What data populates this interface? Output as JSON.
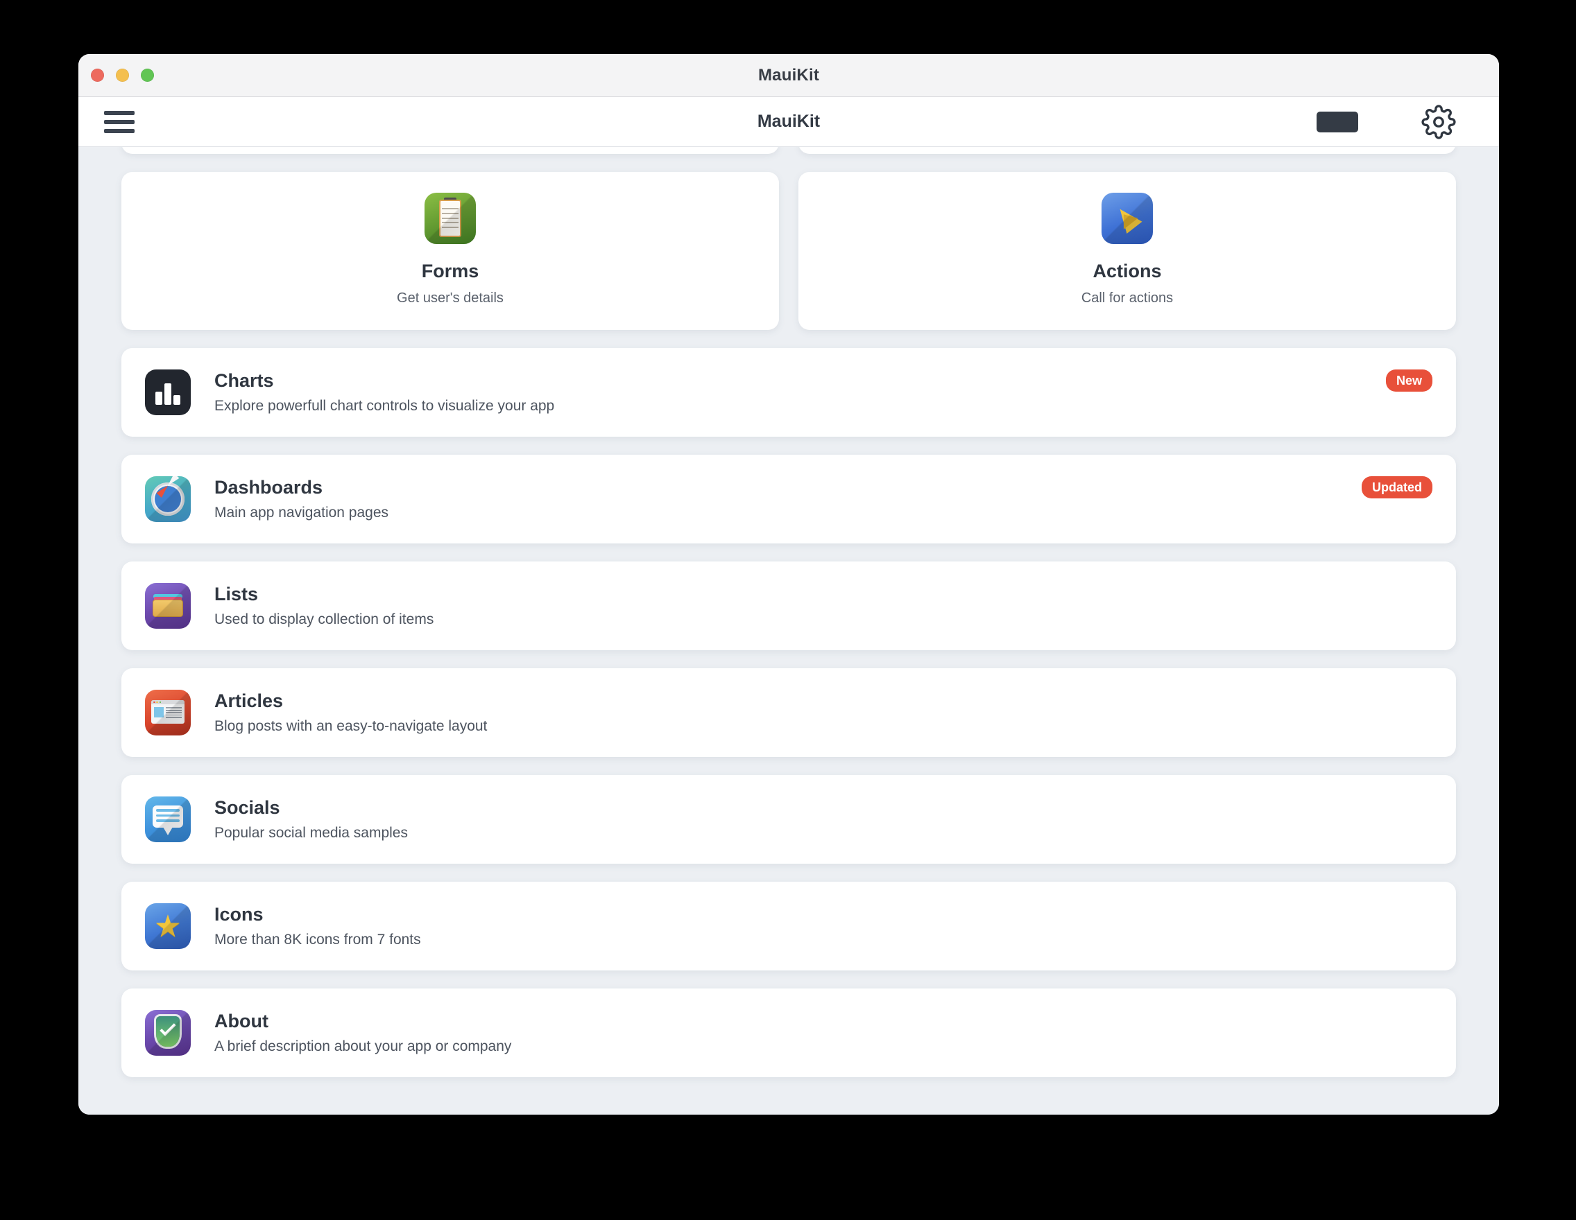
{
  "window": {
    "title": "MauiKit",
    "traffic_lights": {
      "close_color": "#ED6A5E",
      "minimize_color": "#F4BF4F",
      "maximize_color": "#61C554"
    }
  },
  "toolbar": {
    "menu_icon": "hamburger-menu-icon",
    "title": "MauiKit",
    "theme_toggle_icon": "dark-mode-toggle",
    "settings_icon": "gear-icon",
    "background": "#FFFFFF"
  },
  "theme": {
    "page_background": "#ECEFF3",
    "card_background": "#FFFFFF",
    "badge_color": "#E8503A",
    "title_color": "#2F3640",
    "subtitle_color": "#4D545F"
  },
  "feature_cards": [
    {
      "title": "Forms",
      "subtitle": "Get user's details",
      "icon": "clipboard-icon",
      "icon_class": "ico-forms"
    },
    {
      "title": "Actions",
      "subtitle": "Call for actions",
      "icon": "paper-plane-icon",
      "icon_class": "ico-actions"
    }
  ],
  "list_rows": [
    {
      "title": "Charts",
      "subtitle": "Explore powerfull chart controls to visualize your app",
      "icon": "bar-chart-icon",
      "icon_class": "ico-charts",
      "badge": "New"
    },
    {
      "title": "Dashboards",
      "subtitle": "Main app navigation pages",
      "icon": "compass-icon",
      "icon_class": "ico-dash",
      "badge": "Updated"
    },
    {
      "title": "Lists",
      "subtitle": "Used to display collection of items",
      "icon": "card-stack-icon",
      "icon_class": "ico-lists",
      "badge": ""
    },
    {
      "title": "Articles",
      "subtitle": "Blog posts with an easy-to-navigate layout",
      "icon": "browser-window-icon",
      "icon_class": "ico-articles",
      "badge": ""
    },
    {
      "title": "Socials",
      "subtitle": "Popular social media samples",
      "icon": "speech-bubble-icon",
      "icon_class": "ico-socials",
      "badge": ""
    },
    {
      "title": "Icons",
      "subtitle": "More than 8K icons from 7 fonts",
      "icon": "star-icon",
      "icon_class": "ico-icons",
      "badge": ""
    },
    {
      "title": "About",
      "subtitle": "A brief description about your app or company",
      "icon": "shield-check-icon",
      "icon_class": "ico-about",
      "badge": ""
    }
  ]
}
